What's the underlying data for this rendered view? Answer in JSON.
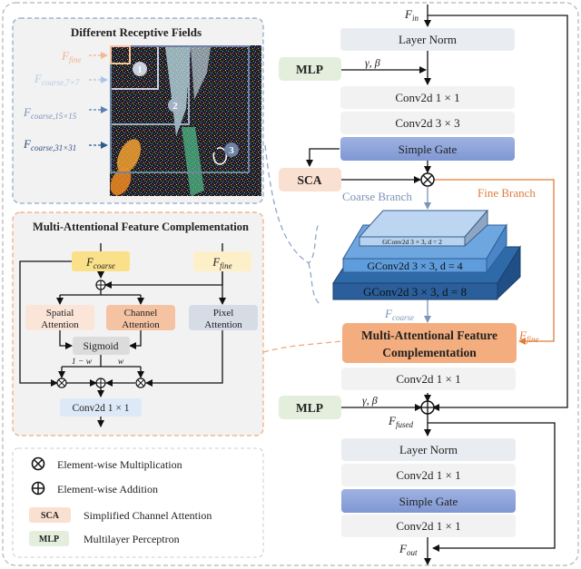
{
  "colors": {
    "layer_norm": "#e9edf2",
    "conv": "#f2f2f3",
    "simple_gate": "#8ea3d8",
    "mlp": "#e3efdc",
    "sca": "#fae0d0",
    "mafc": "#f4ad7e",
    "fine_branch": "#e07b3a",
    "coarse_branch": "#7b93b8",
    "f_coarse_box": "#fbe08a",
    "f_fine_box": "#fdf0c8",
    "spatial_att": "#fbe5d9",
    "channel_att": "#f6c3a2",
    "pixel_att": "#d6dce5",
    "sigmoid": "#dcdcdc",
    "conv_blue": "#dde9f6",
    "gconv_d2": "#b7d3ef",
    "gconv_d4": "#5e9cdc",
    "gconv_d8": "#2f6aa8"
  },
  "receptive": {
    "title": "Different Receptive Fields",
    "labels": [
      {
        "main": "F",
        "sub": "fine"
      },
      {
        "main": "F",
        "sub": "coarse,7×7"
      },
      {
        "main": "F",
        "sub": "coarse,15×15"
      },
      {
        "main": "F",
        "sub": "coarse,31×31"
      }
    ],
    "markers": [
      "1",
      "2",
      "3"
    ]
  },
  "mafc_panel": {
    "title": "Multi-Attentional Feature Complementation",
    "f_coarse": {
      "main": "F",
      "sub": "coarse"
    },
    "f_fine": {
      "main": "F",
      "sub": "fine"
    },
    "spatial": [
      "Spatial",
      "Attention"
    ],
    "channel": [
      "Channel",
      "Attention"
    ],
    "pixel": [
      "Pixel",
      "Attention"
    ],
    "sigmoid": "Sigmoid",
    "one_minus_w": "1 − w",
    "w": "w",
    "conv": "Conv2d 1 × 1"
  },
  "legend": {
    "items": [
      {
        "symbol": "⊗",
        "label": "Element-wise Multiplication"
      },
      {
        "symbol": "⊕",
        "label": "Element-wise Addition"
      },
      {
        "symbol": "SCA",
        "label": "Simplified Channel Attention"
      },
      {
        "symbol": "MLP",
        "label": "Multilayer Perceptron"
      }
    ]
  },
  "main": {
    "f_in": {
      "main": "F",
      "sub": "in"
    },
    "layer_norm_1": "Layer Norm",
    "mlp_1": "MLP",
    "gamma_beta_1": "γ, β",
    "conv1x1_1": "Conv2d  1 × 1",
    "conv3x3": "Conv2d  3 × 3",
    "simple_gate_1": "Simple Gate",
    "sca": "SCA",
    "coarse_branch": "Coarse Branch",
    "fine_branch": "Fine Branch",
    "gconv_d2": "GConv2d  3 × 3, d = 2",
    "gconv_d4": "GConv2d  3 × 3, d = 4",
    "gconv_d8": "GConv2d  3 × 3, d = 8",
    "f_coarse": {
      "main": "F",
      "sub": "coarse"
    },
    "f_fine": {
      "main": "F",
      "sub": "fine"
    },
    "mafc": [
      "Multi-Attentional Feature",
      "Complementation"
    ],
    "conv1x1_2": "Conv2d  1 × 1",
    "mlp_2": "MLP",
    "gamma_beta_2": "γ, β",
    "f_fused": {
      "main": "F",
      "sub": "fused"
    },
    "layer_norm_2": "Layer Norm",
    "conv1x1_3": "Conv2d  1 × 1",
    "simple_gate_2": "Simple Gate",
    "conv1x1_4": "Conv2d  1 × 1",
    "f_out": {
      "main": "F",
      "sub": "out"
    }
  }
}
